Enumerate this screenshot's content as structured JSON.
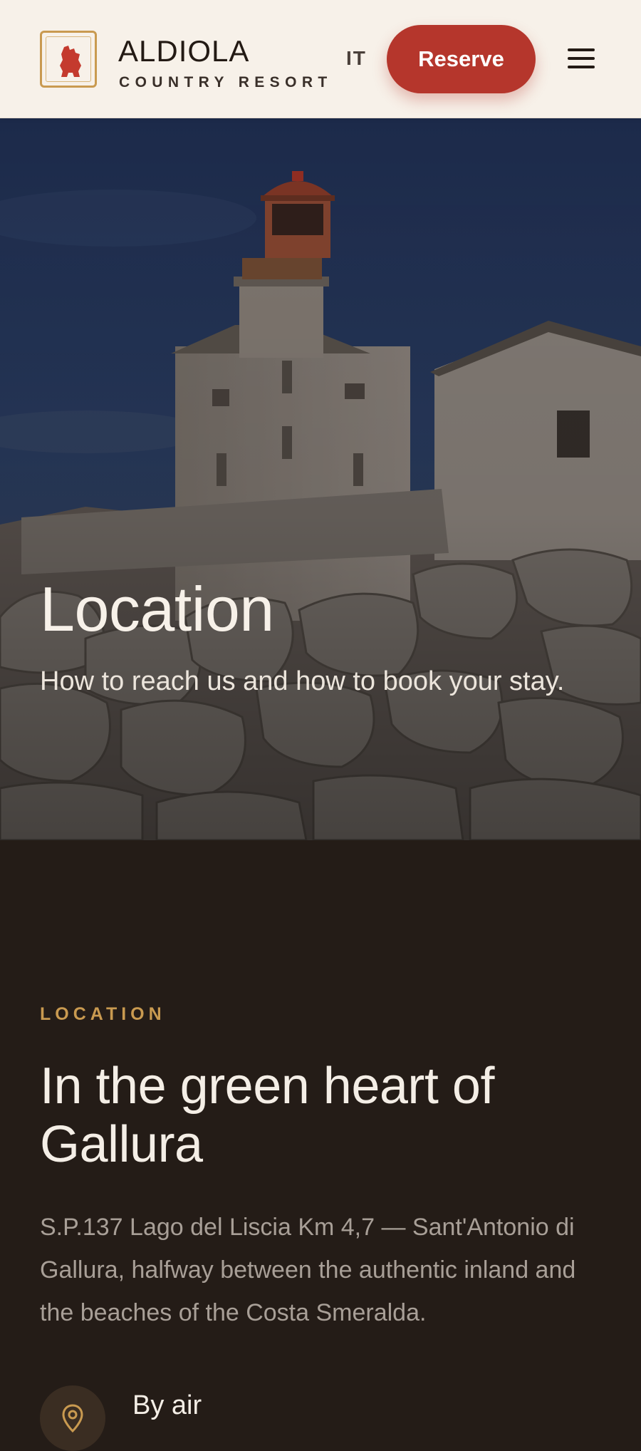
{
  "header": {
    "brand_name": "ALDIOLA",
    "brand_sub": "COUNTRY RESORT",
    "lang": "IT",
    "reserve_label": "Reserve",
    "logo_icon": "boar-icon",
    "menu_icon": "hamburger-menu-icon"
  },
  "hero": {
    "title": "Location",
    "subtitle": "How to reach us and how to book your stay.",
    "image": "lighthouse-on-granite-rocks"
  },
  "location": {
    "eyebrow": "LOCATION",
    "title": "In the green heart of Gallura",
    "address": "S.P.137 Lago del Liscia Km 4,7 — Sant'Antonio di Gallura, halfway between the authentic inland and the beaches of the Costa Smeralda.",
    "by_air": {
      "title": "By air",
      "icon": "pin-icon"
    }
  },
  "colors": {
    "header_bg": "#f7f1e9",
    "accent_red": "#b5362c",
    "accent_gold": "#c99a50",
    "dark_bg": "#241c17",
    "body_text": "#a89f97"
  }
}
